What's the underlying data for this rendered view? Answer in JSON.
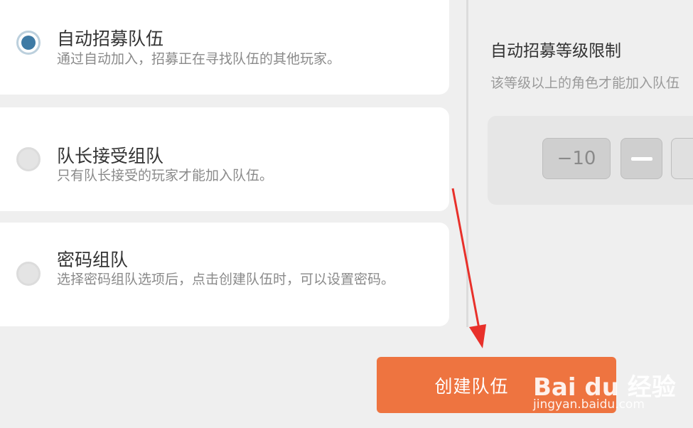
{
  "options": [
    {
      "title": "自动招募队伍",
      "desc": "通过自动加入，招募正在寻找队伍的其他玩家。",
      "selected": true
    },
    {
      "title": "队长接受组队",
      "desc": "只有队长接受的玩家才能加入队伍。",
      "selected": false
    },
    {
      "title": "密码组队",
      "desc": "选择密码组队选项后，点击创建队伍时，可以设置密码。",
      "selected": false
    }
  ],
  "level_limit": {
    "title": "自动招募等级限制",
    "desc": "该等级以上的角色才能加入队伍",
    "minus_ten_label": "−10"
  },
  "create_button": {
    "label": "创建队伍"
  },
  "watermark": {
    "brand": "Bai du 经验",
    "sub": "jingyan.baidu.com"
  },
  "colors": {
    "accent_orange": "#ee7440",
    "radio_selected": "#3e7aa4",
    "annotation_arrow": "#e8302a"
  }
}
